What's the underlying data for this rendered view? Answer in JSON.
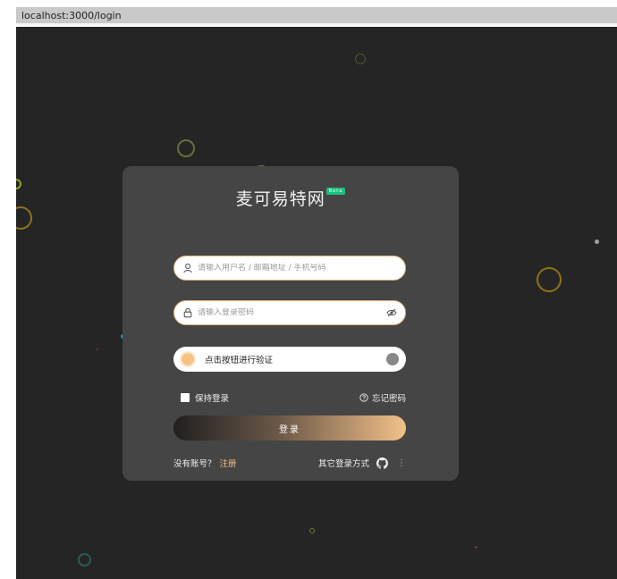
{
  "browser": {
    "url": "localhost:3000/login"
  },
  "login": {
    "title": "麦可易特网",
    "badge": "Beta",
    "username_placeholder": "请输入用户名 / 邮箱地址 / 手机号码",
    "password_placeholder": "请输入登录密码",
    "captcha_text": "点击按钮进行验证",
    "remember_label": "保持登录",
    "forgot_label": "忘记密码",
    "submit_label": "登录",
    "no_account_label": "没有账号？",
    "register_label": "注册",
    "other_login_label": "其它登录方式"
  },
  "icons": {
    "user": "user-icon",
    "lock": "lock-icon",
    "eye": "eye-icon",
    "question": "question-circle-icon",
    "github": "github-icon",
    "more": "more-vertical-icon"
  },
  "colors": {
    "background": "#252525",
    "card": "#454545",
    "accent": "#f2c08a",
    "badge": "#1fbf80"
  }
}
